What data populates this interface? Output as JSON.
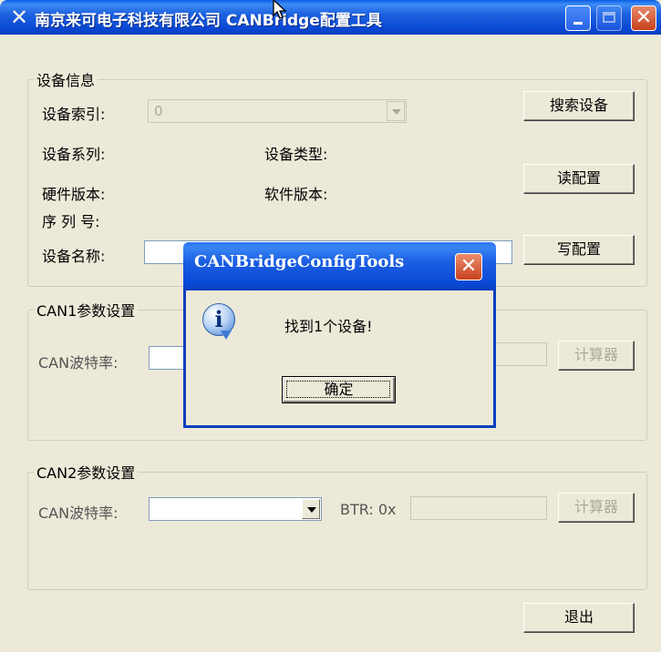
{
  "window": {
    "title": "南京来可电子科技有限公司 CANBridge配置工具",
    "icon": "tools-icon"
  },
  "device_info": {
    "legend": "设备信息",
    "index_label": "设备索引:",
    "index_value": "0",
    "series_label": "设备系列:",
    "type_label": "设备类型:",
    "hw_label": "硬件版本:",
    "sw_label": "软件版本:",
    "serial_label": "序 列 号:",
    "name_label": "设备名称:",
    "search_button": "搜索设备",
    "read_button": "读配置",
    "write_button": "写配置"
  },
  "can1": {
    "legend": "CAN1参数设置",
    "baud_label": "CAN波特率:",
    "calc_button": "计算器"
  },
  "can2": {
    "legend": "CAN2参数设置",
    "baud_label": "CAN波特率:",
    "btr_label": "BTR: 0x",
    "calc_button": "计算器"
  },
  "exit_button": "退出",
  "dialog": {
    "title": "CANBridgeConfigTools",
    "message": "找到1个设备!",
    "ok_button": "确定",
    "icon": "info-icon"
  },
  "colors": {
    "titlebar": "#0a49d6",
    "face": "#ece9d8",
    "close": "#c7401d"
  }
}
